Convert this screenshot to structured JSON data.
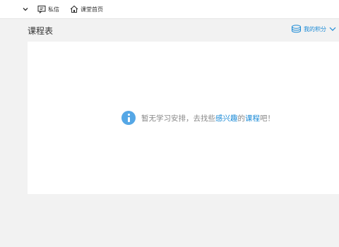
{
  "topbar": {
    "messages_label": "私信",
    "home_label": "课堂首页"
  },
  "page": {
    "title": "课程表",
    "points_label": "我的积分"
  },
  "empty_state": {
    "prefix": "暂无学习安排，去找些",
    "link_interest": "感兴趣",
    "middle": "的",
    "link_course": "课程",
    "suffix": "吧！"
  },
  "icons": {
    "dropdown": "chevron-down-icon",
    "messages": "message-icon",
    "home": "home-icon",
    "points": "coins-icon",
    "info": "info-icon"
  },
  "colors": {
    "accent": "#1a8ad6",
    "info": "#55a7e6",
    "background": "#f2f2f2",
    "panel": "#ffffff"
  }
}
